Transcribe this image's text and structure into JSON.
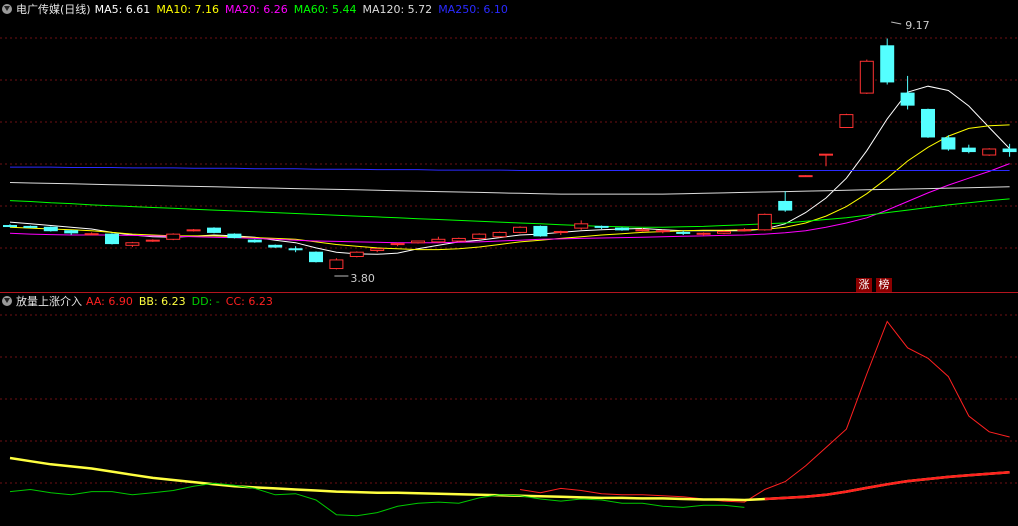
{
  "main": {
    "title": "电广传媒(日线)",
    "ma": [
      {
        "label": "MA5:",
        "value": "6.61",
        "color": "#ffffff"
      },
      {
        "label": "MA10:",
        "value": "7.16",
        "color": "#ffff00"
      },
      {
        "label": "MA20:",
        "value": "6.26",
        "color": "#ff00ff"
      },
      {
        "label": "MA60:",
        "value": "5.44",
        "color": "#00ff00"
      },
      {
        "label": "MA120:",
        "value": "5.72",
        "color": "#dcdcdc"
      },
      {
        "label": "MA250:",
        "value": "6.10",
        "color": "#2a2aff"
      }
    ],
    "high_label": "9.17",
    "low_label": "3.80",
    "badges": [
      {
        "text": "涨",
        "color": "#ffffff",
        "bg": "#8c0000"
      },
      {
        "text": "榜",
        "color": "#ffffff",
        "bg": "#8c0000"
      }
    ]
  },
  "indicator": {
    "title": "放量上涨介入",
    "items": [
      {
        "label": "AA:",
        "value": "6.90",
        "color": "#ff2020"
      },
      {
        "label": "BB:",
        "value": "6.23",
        "color": "#ffff40"
      },
      {
        "label": "DD:",
        "value": "-",
        "color": "#00d000"
      },
      {
        "label": "CC:",
        "value": "6.23",
        "color": "#ff2020"
      }
    ]
  },
  "chart_data": [
    {
      "type": "candlestick",
      "title": "电广传媒(日线)",
      "ohlc": [
        [
          4.82,
          4.85,
          4.78,
          4.8
        ],
        [
          4.8,
          4.82,
          4.76,
          4.78
        ],
        [
          4.78,
          4.8,
          4.68,
          4.7
        ],
        [
          4.7,
          4.72,
          4.6,
          4.65
        ],
        [
          4.62,
          4.66,
          4.6,
          4.63
        ],
        [
          4.62,
          4.64,
          4.38,
          4.4
        ],
        [
          4.36,
          4.44,
          4.32,
          4.42
        ],
        [
          4.46,
          4.5,
          4.44,
          4.48
        ],
        [
          4.5,
          4.64,
          4.48,
          4.62
        ],
        [
          4.7,
          4.74,
          4.68,
          4.72
        ],
        [
          4.76,
          4.78,
          4.64,
          4.66
        ],
        [
          4.62,
          4.64,
          4.52,
          4.54
        ],
        [
          4.48,
          4.5,
          4.42,
          4.44
        ],
        [
          4.36,
          4.38,
          4.3,
          4.32
        ],
        [
          4.28,
          4.34,
          4.2,
          4.26
        ],
        [
          4.2,
          4.22,
          3.96,
          3.98
        ],
        [
          3.82,
          4.06,
          3.8,
          4.02
        ],
        [
          4.1,
          4.22,
          4.08,
          4.2
        ],
        [
          4.24,
          4.3,
          4.2,
          4.28
        ],
        [
          4.4,
          4.42,
          4.34,
          4.4
        ],
        [
          4.42,
          4.46,
          4.4,
          4.46
        ],
        [
          4.44,
          4.56,
          4.42,
          4.5
        ],
        [
          4.46,
          4.54,
          4.44,
          4.52
        ],
        [
          4.52,
          4.64,
          4.5,
          4.62
        ],
        [
          4.56,
          4.68,
          4.54,
          4.66
        ],
        [
          4.66,
          4.8,
          4.64,
          4.78
        ],
        [
          4.8,
          4.82,
          4.56,
          4.58
        ],
        [
          4.66,
          4.7,
          4.6,
          4.68
        ],
        [
          4.76,
          4.94,
          4.72,
          4.86
        ],
        [
          4.8,
          4.82,
          4.74,
          4.78
        ],
        [
          4.76,
          4.78,
          4.7,
          4.72
        ],
        [
          4.7,
          4.76,
          4.68,
          4.72
        ],
        [
          4.68,
          4.72,
          4.64,
          4.7
        ],
        [
          4.66,
          4.7,
          4.6,
          4.64
        ],
        [
          4.62,
          4.66,
          4.58,
          4.64
        ],
        [
          4.64,
          4.7,
          4.62,
          4.68
        ],
        [
          4.7,
          4.76,
          4.68,
          4.72
        ],
        [
          4.72,
          5.1,
          4.7,
          5.08
        ],
        [
          5.38,
          5.62,
          5.14,
          5.18
        ],
        [
          5.98,
          5.99,
          5.97,
          5.98
        ],
        [
          6.48,
          6.48,
          6.2,
          6.48
        ],
        [
          7.1,
          7.42,
          7.1,
          7.4
        ],
        [
          7.9,
          8.68,
          7.88,
          8.64
        ],
        [
          9.0,
          9.17,
          8.1,
          8.16
        ],
        [
          7.9,
          8.3,
          7.52,
          7.62
        ],
        [
          7.52,
          7.54,
          6.86,
          6.88
        ],
        [
          6.86,
          6.92,
          6.56,
          6.6
        ],
        [
          6.62,
          6.7,
          6.5,
          6.54
        ],
        [
          6.46,
          6.62,
          6.44,
          6.6
        ],
        [
          6.6,
          6.72,
          6.42,
          6.54
        ]
      ],
      "series": [
        {
          "name": "MA5",
          "values": [
            4.9,
            4.86,
            4.82,
            4.78,
            4.74,
            4.66,
            4.6,
            4.56,
            4.55,
            4.57,
            4.6,
            4.58,
            4.55,
            4.48,
            4.42,
            4.3,
            4.2,
            4.16,
            4.15,
            4.18,
            4.28,
            4.36,
            4.44,
            4.48,
            4.54,
            4.6,
            4.62,
            4.66,
            4.7,
            4.72,
            4.74,
            4.75,
            4.72,
            4.7,
            4.7,
            4.7,
            4.7,
            4.74,
            4.86,
            5.12,
            5.46,
            5.92,
            6.56,
            7.3,
            7.92,
            8.06,
            7.96,
            7.6,
            7.1,
            6.61
          ]
        },
        {
          "name": "MA10",
          "values": [
            4.78,
            4.76,
            4.74,
            4.72,
            4.7,
            4.66,
            4.62,
            4.6,
            4.58,
            4.58,
            4.58,
            4.56,
            4.54,
            4.52,
            4.5,
            4.44,
            4.38,
            4.34,
            4.3,
            4.28,
            4.26,
            4.26,
            4.28,
            4.32,
            4.38,
            4.44,
            4.48,
            4.52,
            4.56,
            4.6,
            4.63,
            4.66,
            4.68,
            4.7,
            4.71,
            4.71,
            4.72,
            4.73,
            4.78,
            4.88,
            5.04,
            5.26,
            5.56,
            5.92,
            6.32,
            6.64,
            6.9,
            7.08,
            7.14,
            7.16
          ]
        },
        {
          "name": "MA20",
          "values": [
            4.64,
            4.62,
            4.61,
            4.6,
            4.6,
            4.6,
            4.59,
            4.58,
            4.57,
            4.56,
            4.55,
            4.54,
            4.52,
            4.5,
            4.48,
            4.46,
            4.45,
            4.44,
            4.43,
            4.42,
            4.42,
            4.42,
            4.43,
            4.44,
            4.46,
            4.48,
            4.5,
            4.51,
            4.52,
            4.53,
            4.54,
            4.55,
            4.56,
            4.57,
            4.58,
            4.59,
            4.6,
            4.62,
            4.65,
            4.7,
            4.78,
            4.88,
            5.0,
            5.18,
            5.38,
            5.58,
            5.76,
            5.92,
            6.08,
            6.26
          ]
        },
        {
          "name": "MA60",
          "values": [
            5.4,
            5.38,
            5.35,
            5.33,
            5.3,
            5.28,
            5.26,
            5.24,
            5.22,
            5.2,
            5.18,
            5.16,
            5.14,
            5.12,
            5.1,
            5.08,
            5.06,
            5.04,
            5.02,
            5.0,
            4.98,
            4.96,
            4.94,
            4.92,
            4.9,
            4.88,
            4.86,
            4.84,
            4.82,
            4.8,
            4.79,
            4.78,
            4.78,
            4.79,
            4.8,
            4.82,
            4.84,
            4.86,
            4.88,
            4.92,
            4.96,
            5.0,
            5.06,
            5.12,
            5.18,
            5.24,
            5.3,
            5.35,
            5.4,
            5.44
          ]
        },
        {
          "name": "MA120",
          "values": [
            5.82,
            5.81,
            5.8,
            5.79,
            5.78,
            5.77,
            5.76,
            5.75,
            5.74,
            5.73,
            5.72,
            5.71,
            5.7,
            5.69,
            5.68,
            5.67,
            5.66,
            5.65,
            5.64,
            5.63,
            5.62,
            5.61,
            5.6,
            5.59,
            5.58,
            5.57,
            5.56,
            5.55,
            5.55,
            5.55,
            5.55,
            5.55,
            5.55,
            5.56,
            5.57,
            5.58,
            5.59,
            5.6,
            5.61,
            5.62,
            5.63,
            5.64,
            5.65,
            5.66,
            5.67,
            5.68,
            5.69,
            5.7,
            5.71,
            5.72
          ]
        },
        {
          "name": "MA250",
          "values": [
            6.18,
            6.18,
            6.18,
            6.17,
            6.17,
            6.17,
            6.16,
            6.16,
            6.16,
            6.15,
            6.15,
            6.15,
            6.14,
            6.14,
            6.14,
            6.13,
            6.13,
            6.13,
            6.12,
            6.12,
            6.12,
            6.11,
            6.11,
            6.11,
            6.11,
            6.1,
            6.1,
            6.1,
            6.1,
            6.1,
            6.1,
            6.1,
            6.1,
            6.1,
            6.1,
            6.1,
            6.1,
            6.1,
            6.1,
            6.1,
            6.1,
            6.1,
            6.1,
            6.1,
            6.1,
            6.1,
            6.1,
            6.1,
            6.1,
            6.1
          ]
        }
      ],
      "annotations": [
        "9.17",
        "3.80"
      ],
      "grid": true
    },
    {
      "type": "line",
      "title": "放量上涨介入",
      "series": [
        {
          "name": "AA",
          "values": [
            null,
            null,
            null,
            null,
            null,
            null,
            null,
            null,
            null,
            null,
            null,
            null,
            null,
            null,
            null,
            null,
            null,
            null,
            null,
            null,
            null,
            null,
            null,
            null,
            null,
            5.9,
            5.84,
            5.92,
            5.88,
            5.82,
            5.8,
            5.8,
            5.78,
            5.76,
            5.72,
            5.68,
            5.66,
            5.9,
            6.05,
            6.35,
            6.7,
            7.05,
            8.1,
            9.1,
            8.6,
            8.4,
            8.05,
            7.3,
            7.0,
            6.9
          ]
        },
        {
          "name": "BB",
          "values": [
            6.5,
            6.44,
            6.38,
            6.34,
            6.3,
            6.24,
            6.18,
            6.12,
            6.08,
            6.04,
            6.0,
            5.96,
            5.94,
            5.92,
            5.9,
            5.88,
            5.86,
            5.85,
            5.84,
            5.84,
            5.83,
            5.82,
            5.81,
            5.8,
            5.79,
            5.78,
            5.77,
            5.76,
            5.75,
            5.74,
            5.74,
            5.73,
            5.73,
            5.72,
            5.71,
            5.71,
            5.7,
            5.72,
            5.74,
            5.76,
            5.8,
            5.86,
            5.93,
            6.0,
            6.06,
            6.1,
            6.14,
            6.17,
            6.2,
            6.23
          ]
        },
        {
          "name": "DD",
          "values": [
            5.86,
            5.9,
            5.84,
            5.8,
            5.86,
            5.86,
            5.8,
            5.84,
            5.88,
            5.96,
            6.02,
            5.98,
            5.92,
            5.8,
            5.82,
            5.7,
            5.42,
            5.4,
            5.46,
            5.58,
            5.64,
            5.66,
            5.64,
            5.74,
            5.8,
            5.78,
            5.72,
            5.68,
            5.72,
            5.7,
            5.64,
            5.64,
            5.58,
            5.56,
            5.6,
            5.6,
            5.56,
            null,
            null,
            null,
            null,
            null,
            null,
            null,
            null,
            null,
            null,
            null,
            null,
            null
          ]
        },
        {
          "name": "CC",
          "values": [
            null,
            null,
            null,
            null,
            null,
            null,
            null,
            null,
            null,
            null,
            null,
            null,
            null,
            null,
            null,
            null,
            null,
            null,
            null,
            null,
            null,
            null,
            null,
            null,
            null,
            null,
            null,
            null,
            null,
            null,
            null,
            null,
            null,
            null,
            null,
            null,
            null,
            5.72,
            5.74,
            5.76,
            5.8,
            5.86,
            5.93,
            6.0,
            6.06,
            6.1,
            6.14,
            6.17,
            6.2,
            6.23
          ]
        }
      ],
      "grid": true
    }
  ]
}
